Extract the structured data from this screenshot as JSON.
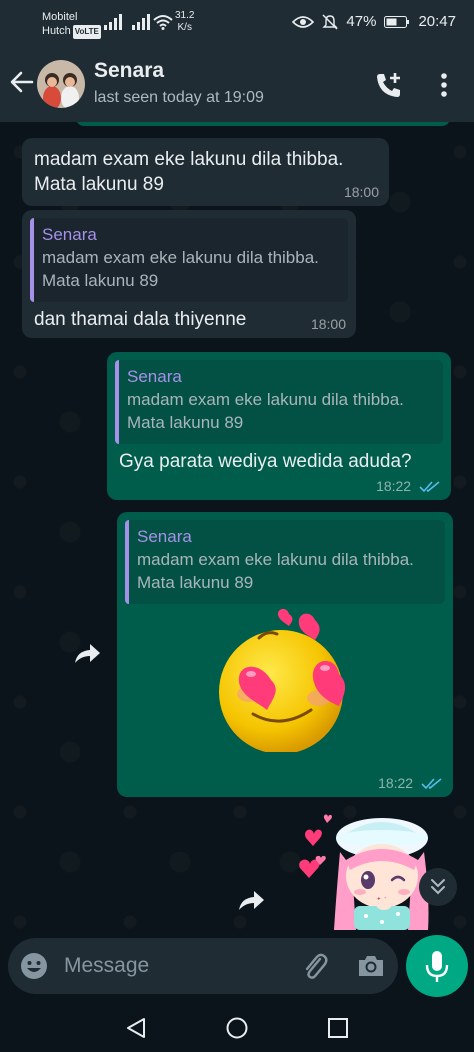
{
  "status_bar": {
    "carrier_1": "Mobitel",
    "carrier_2": "Hutch",
    "volte": "VoLTE",
    "net_speed_value": "31.2",
    "net_speed_unit": "K/s",
    "battery": "47%",
    "time": "20:47"
  },
  "header": {
    "contact_name": "Senara",
    "last_seen": "last seen today at 19:09"
  },
  "messages": [
    {
      "direction": "in",
      "text_line_1": "madam exam eke lakunu dila thibba.",
      "text_line_2": "Mata lakunu 89",
      "time": "18:00"
    },
    {
      "direction": "in",
      "quote_author": "Senara",
      "quote_line_1": "madam exam eke lakunu dila thibba.",
      "quote_line_2": "Mata lakunu 89",
      "text": "dan thamai dala thiyenne",
      "time": "18:00"
    },
    {
      "direction": "out",
      "quote_author": "Senara",
      "quote_line_1": "madam exam eke lakunu dila thibba.",
      "quote_line_2": "Mata lakunu 89",
      "text": "Gya parata wediya wedida aduda?",
      "time": "18:22"
    },
    {
      "direction": "out",
      "quote_author": "Senara",
      "quote_line_1": "madam exam eke lakunu dila thibba.",
      "quote_line_2": "Mata lakunu 89",
      "sticker": "heart-eyes-emoji",
      "time": "18:22"
    },
    {
      "direction": "out",
      "sticker": "anime-girl-winking-sticker"
    }
  ],
  "composer": {
    "placeholder": "Message"
  },
  "colors": {
    "bg": "#0b141a",
    "bar": "#1f2c34",
    "incoming": "#1f2c34",
    "outgoing": "#005c4b",
    "accent": "#00a884",
    "quote_author": "#a791e8",
    "read_ticks": "#53bdeb"
  }
}
